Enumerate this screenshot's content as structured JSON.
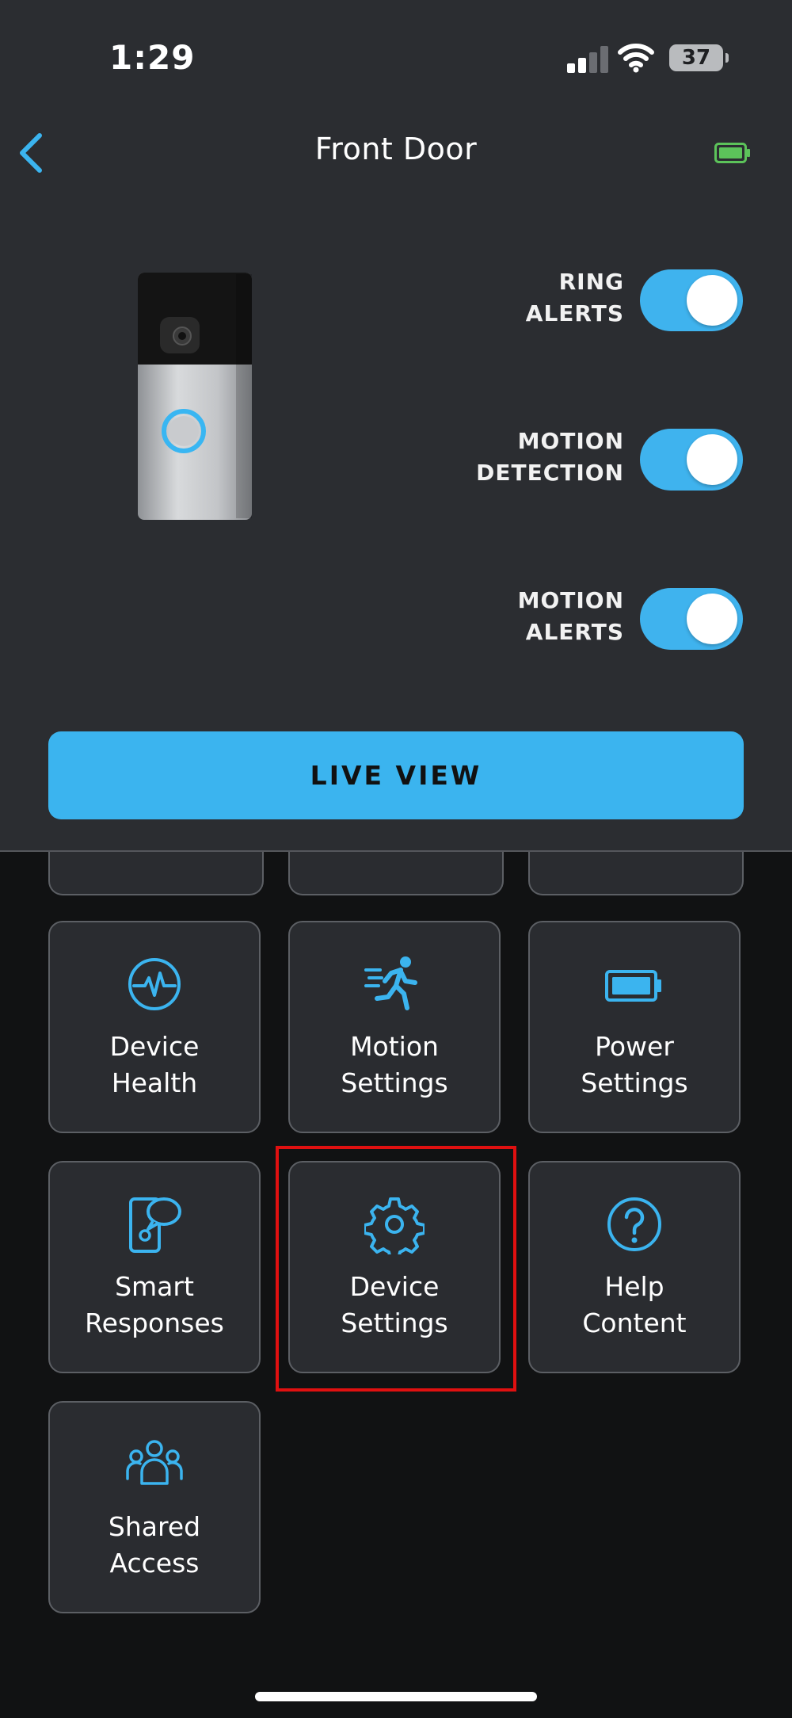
{
  "status_bar": {
    "time": "1:29",
    "battery": "37"
  },
  "header": {
    "title": "Front Door",
    "back_icon": "chevron-left-icon",
    "battery_icon": "battery-full-icon"
  },
  "toggles": [
    {
      "line1": "RING",
      "line2": "ALERTS",
      "on": true
    },
    {
      "line1": "MOTION",
      "line2": "DETECTION",
      "on": true
    },
    {
      "line1": "MOTION",
      "line2": "ALERTS",
      "on": true
    }
  ],
  "live_view": {
    "label": "LIVE VIEW"
  },
  "tiles": [
    {
      "line1": "Device",
      "line2": "Health",
      "icon": "pulse-icon"
    },
    {
      "line1": "Motion",
      "line2": "Settings",
      "icon": "running-person-icon"
    },
    {
      "line1": "Power",
      "line2": "Settings",
      "icon": "battery-icon"
    },
    {
      "line1": "Smart",
      "line2": "Responses",
      "icon": "smart-responses-icon"
    },
    {
      "line1": "Device",
      "line2": "Settings",
      "icon": "gear-icon"
    },
    {
      "line1": "Help",
      "line2": "Content",
      "icon": "question-icon"
    },
    {
      "line1": "Shared",
      "line2": "Access",
      "icon": "users-icon"
    }
  ],
  "colors": {
    "accent": "#3bb4ef",
    "top_bg": "#2b2d31",
    "bottom_bg": "#111213",
    "highlight": "#e01010"
  }
}
